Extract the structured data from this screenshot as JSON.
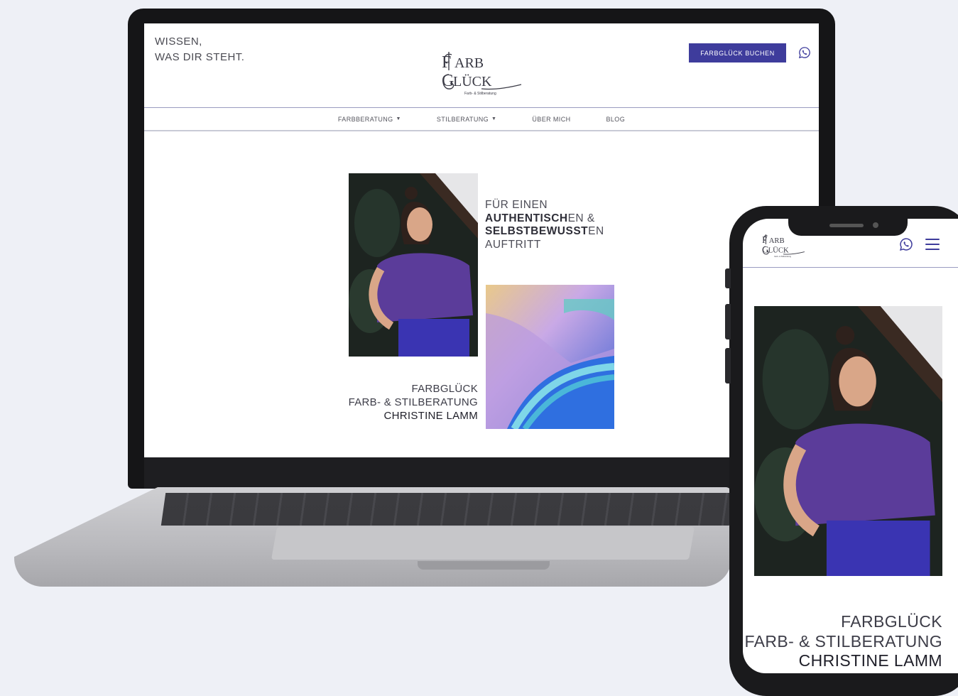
{
  "desktop": {
    "tagline": [
      "WISSEN,",
      "WAS DIR STEHT."
    ],
    "logo": {
      "line1": "ARB",
      "line2": "LÜCK",
      "initial1": "F",
      "initial2": "G",
      "subtitle": "Farb- & Stilberatung"
    },
    "book_button": "FARBGLÜCK BUCHEN",
    "nav": [
      {
        "label": "FARBBERATUNG",
        "has_dropdown": true
      },
      {
        "label": "STILBERATUNG",
        "has_dropdown": true
      },
      {
        "label": "ÜBER MICH",
        "has_dropdown": false
      },
      {
        "label": "BLOG",
        "has_dropdown": false
      }
    ],
    "slogan": {
      "line1": "FÜR EINEN",
      "line2_bold": "AUTHENTISCH",
      "line2_light": "EN &",
      "line3_bold": "SELBSTBEWUSST",
      "line3_light": "EN",
      "line4": "AUFTRITT"
    },
    "brand": {
      "line1": "FARBGLÜCK",
      "line2": "FARB- & STILBERATUNG",
      "line3": "CHRISTINE LAMM"
    }
  },
  "mobile": {
    "brand": {
      "line1": "FARBGLÜCK",
      "line2": "FARB- & STILBERATUNG",
      "line3": "CHRISTINE LAMM"
    }
  },
  "colors": {
    "accent": "#3e3c9c",
    "shirt_purple": "#5b3c9a",
    "background": "#eef0f6"
  },
  "icons": [
    "whatsapp-icon",
    "chevron-down-icon",
    "hamburger-menu-icon"
  ]
}
